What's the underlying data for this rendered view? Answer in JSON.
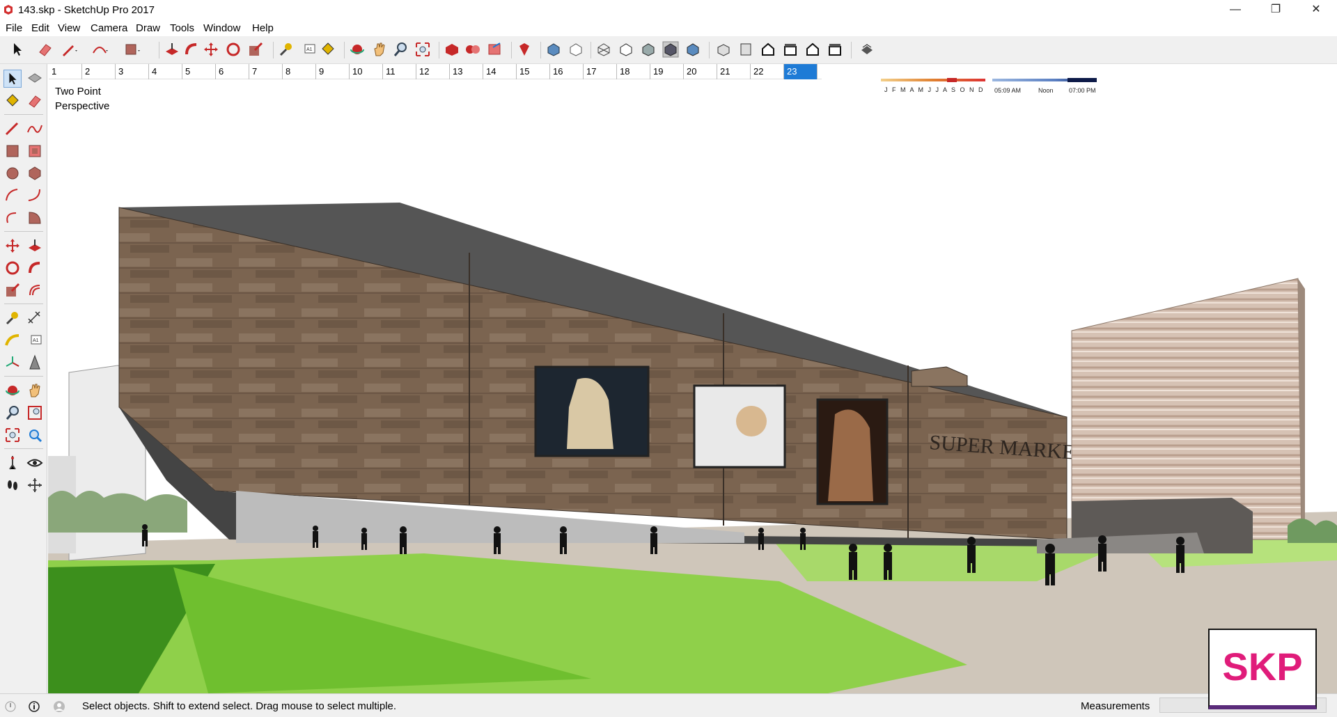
{
  "window": {
    "title": "143.skp - SketchUp Pro 2017",
    "controls": {
      "minimize": "—",
      "restore": "❐",
      "close": "✕"
    }
  },
  "menu": [
    "File",
    "Edit",
    "View",
    "Camera",
    "Draw",
    "Tools",
    "Window",
    "Help"
  ],
  "shadows": {
    "months": "J F M A M J J A S O N D",
    "time_start": "05:09 AM",
    "time_noon": "Noon",
    "time_end": "07:00 PM"
  },
  "scenes": [
    "1",
    "2",
    "3",
    "4",
    "5",
    "6",
    "7",
    "8",
    "9",
    "10",
    "11",
    "12",
    "13",
    "14",
    "15",
    "16",
    "17",
    "18",
    "19",
    "20",
    "21",
    "22",
    "23"
  ],
  "active_scene": "23",
  "viewport": {
    "camera_label_line1": "Two Point",
    "camera_label_line2": "Perspective",
    "building_sign": "SUPER MARKET"
  },
  "status": {
    "hint": "Select objects. Shift to extend select. Drag mouse to select multiple.",
    "measurements_label": "Measurements",
    "measurements_value": ""
  },
  "watermark": "SKP",
  "colors": {
    "accent": "#1e7bd6",
    "watermark": "#e01c7a",
    "facade": "#7b6450",
    "roof": "#555555",
    "grass": "#7cc83c"
  }
}
